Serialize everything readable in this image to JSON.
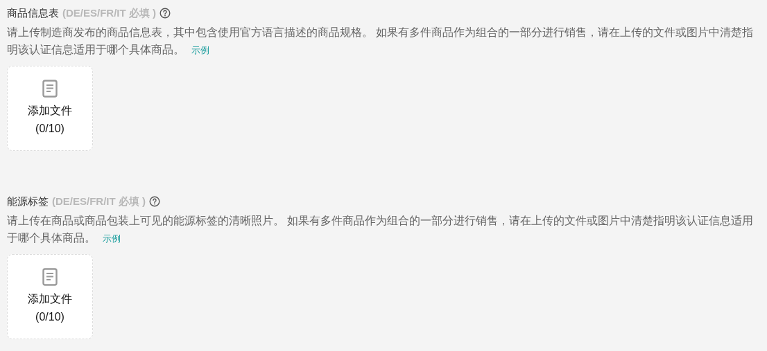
{
  "sections": [
    {
      "title": "商品信息表",
      "required_note": "(DE/ES/FR/IT 必填 )",
      "description": "请上传制造商发布的商品信息表，其中包含使用官方语言描述的商品规格。 如果有多件商品作为组合的一部分进行销售，请在上传的文件或图片中清楚指明该认证信息适用于哪个具体商品。",
      "example_link": "示例",
      "upload": {
        "label": "添加文件",
        "count": "(0/10)"
      }
    },
    {
      "title": "能源标签",
      "required_note": "(DE/ES/FR/IT 必填 )",
      "description": "请上传在商品或商品包装上可见的能源标签的清晰照片。 如果有多件商品作为组合的一部分进行销售，请在上传的文件或图片中清楚指明该认证信息适用于哪个具体商品。",
      "example_link": "示例",
      "upload": {
        "label": "添加文件",
        "count": "(0/10)"
      }
    }
  ]
}
